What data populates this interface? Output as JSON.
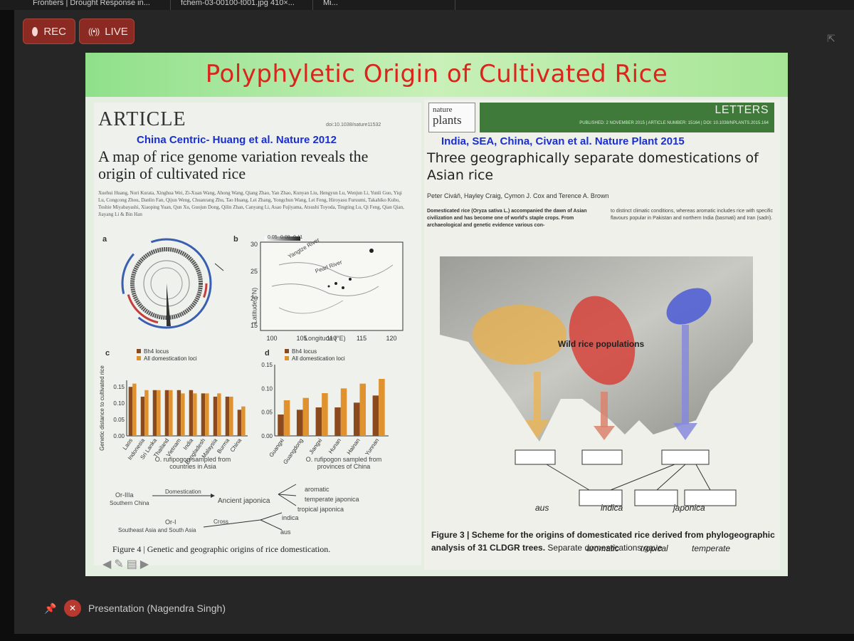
{
  "tabs": [
    {
      "label": "Frontiers | Drought Response in..."
    },
    {
      "label": "fchem-03-00100-t001.jpg 410×..."
    },
    {
      "label": "Mi..."
    }
  ],
  "recording": {
    "rec_label": "REC",
    "live_label": "LIVE"
  },
  "slide": {
    "title": "Polyphyletic Origin of Cultivated Rice",
    "left": {
      "article_label": "ARTICLE",
      "doi": "doi:10.1038/nature11532",
      "annotation": "China Centric- Huang et al. Nature 2012",
      "heading": "A map of rice genome variation reveals the origin of cultivated rice",
      "authors": "Xuehui Huang, Nori Kurata, Xinghua Wei, Zi-Xuan Wang, Ahong Wang, Qiang Zhao, Yan Zhao, Kunyan Liu, Hengyun Lu, Wenjun Li, Yunli Guo, Yiqi Lu, Congcong Zhou, Danlin Fan, Qijun Weng, Chuanrang Zhu, Tao Huang, Lei Zhang, Yongchun Wang, Lei Feng, Hiroyasu Furuumi, Takahiko Kubo, Toshie Miyabayashi, Xiaoping Yuan, Qun Xu, Guojun Dong, Qilin Zhan, Canyang Li, Asao Fujiyama, Atsushi Toyoda, Tingting Lu, Qi Feng, Qian Qian, Jiayang Li & Bin Han",
      "panel_a": "a",
      "panel_b": "b",
      "panel_c": "c",
      "panel_d": "d",
      "panel_e": {
        "orIIIa": "Or-IIIa",
        "southern_china": "Southern China",
        "domestication": "Domestication",
        "ancient_japonica": "Ancient japonica",
        "aromatic": "aromatic",
        "temperate_japonica": "temperate japonica",
        "tropical_japonica": "tropical japonica",
        "indica": "indica",
        "orI": "Or-I",
        "cross": "Cross",
        "se_asia": "Southeast Asia and South Asia",
        "aus": "aus"
      },
      "map_b": {
        "river1": "Yangtze River",
        "river2": "Pearl River",
        "xlabel": "Longitude (°E)",
        "ylabel": "Latitude (°N)",
        "xticks": [
          "100",
          "105",
          "110",
          "115",
          "120"
        ],
        "yticks": [
          "30",
          "25",
          "20",
          "15"
        ],
        "scale": [
          "0.05",
          "0.08",
          "0.11"
        ]
      },
      "panel_c_footer": "O. rufipogon sampled from countries in Asia",
      "panel_d_footer": "O. rufipogon sampled from provinces of China",
      "figure_caption": "Figure 4 | Genetic and geographic origins of rice domestication."
    },
    "right": {
      "logo_line1": "nature",
      "logo_line2": "plants",
      "letters": "LETTERS",
      "published": "PUBLISHED: 2 NOVEMBER 2015 | ARTICLE NUMBER: 15164 | DOI: 10.1038/NPLANTS.2015.164",
      "annotation": "India, SEA, China, Civan et al. Nature Plant 2015",
      "heading": "Three geographically separate domestications of Asian rice",
      "authors": "Peter Civáň, Hayley Craig, Cymon J. Cox and Terence A. Brown",
      "abstract": "Domesticated rice (Oryza sativa L.) accompanied the dawn of Asian civilization and has become one of world's staple crops. From archaeological and genetic evidence various con-",
      "abstract_cont": "to distinct climatic conditions, whereas aromatic includes rice with specific flavours popular in Pakistan and northern India (basmati) and Iran (sadri).",
      "map": {
        "wild_label": "Wild rice populations",
        "aus": "aus",
        "indica": "indica",
        "japonica": "japonica",
        "aromatic": "aromatic",
        "tropical": "tropical",
        "temperate": "temperate"
      },
      "figure_caption_bold": "Figure 3 | Scheme for the origins of domesticated rice derived from phylogeographic analysis of 31 CLDGR trees.",
      "figure_caption_rest": "Separate domestications gave"
    }
  },
  "presenter": "Presentation (Nagendra Singh)",
  "colors": {
    "rec": "#8a2a22",
    "title": "#d9261c",
    "annotation": "#1b2fd0",
    "header_green": "#3f7a3b"
  },
  "chart_data": [
    {
      "type": "bar",
      "panel": "c",
      "categories": [
        "Laos",
        "Indonesia",
        "Sri Lanka",
        "Thailand",
        "Vietnam",
        "India",
        "Bangladesh",
        "Malaysia",
        "Burma",
        "China"
      ],
      "series": [
        {
          "name": "Bh4 locus",
          "values": [
            0.15,
            0.12,
            0.14,
            0.14,
            0.14,
            0.14,
            0.13,
            0.12,
            0.12,
            0.08
          ]
        },
        {
          "name": "All domestication loci",
          "values": [
            0.16,
            0.14,
            0.14,
            0.14,
            0.13,
            0.13,
            0.13,
            0.13,
            0.12,
            0.09
          ]
        }
      ],
      "ylabel": "Genetic distance to cultivated rice",
      "yticks": [
        "0.00",
        "0.05",
        "0.10",
        "0.15"
      ],
      "ylim": [
        0,
        0.17
      ]
    },
    {
      "type": "bar",
      "panel": "d",
      "categories": [
        "Guangxi",
        "Guangdong",
        "Jiangxi",
        "Hunan",
        "Hainan",
        "Yunnan"
      ],
      "series": [
        {
          "name": "Bh4 locus",
          "values": [
            0.045,
            0.055,
            0.06,
            0.06,
            0.07,
            0.085
          ]
        },
        {
          "name": "All domestication loci",
          "values": [
            0.075,
            0.08,
            0.09,
            0.1,
            0.11,
            0.12
          ]
        }
      ],
      "yticks": [
        "0.00",
        "0.05",
        "0.10",
        "0.15"
      ],
      "ylim": [
        0,
        0.15
      ]
    }
  ]
}
